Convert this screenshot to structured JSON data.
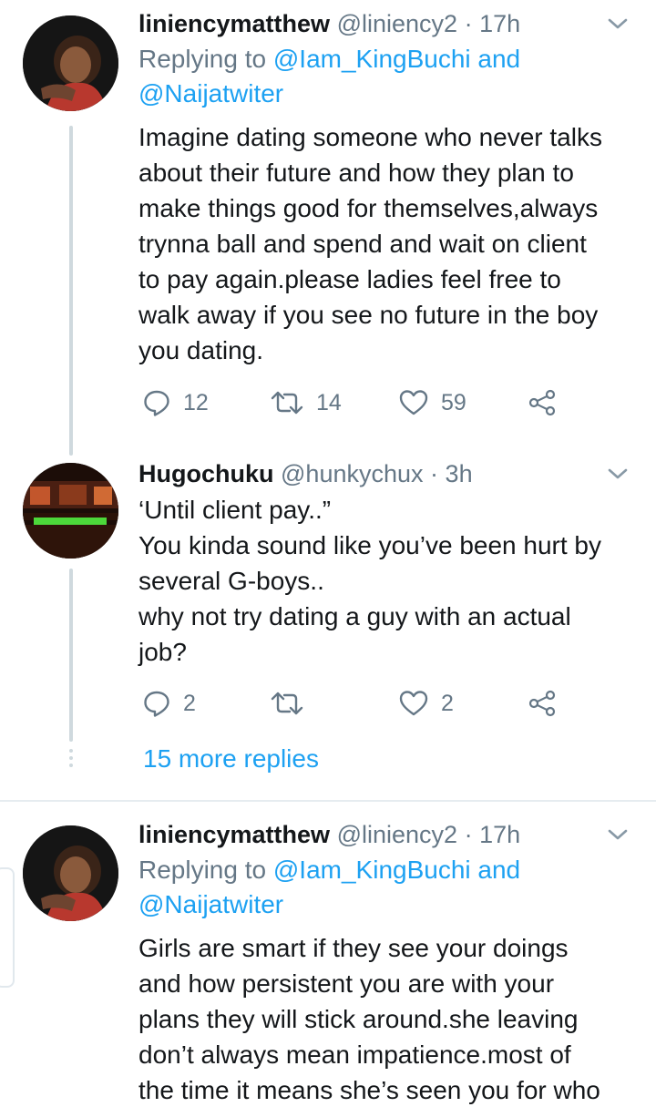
{
  "tweets": [
    {
      "name": "liniencymatthew",
      "handle": "@liniency2",
      "sep": "·",
      "time": "17h",
      "replying_prefix": "Replying to",
      "replying_mentions": "@Iam_KingBuchi and",
      "replying_mentions2": "@Naijatwiter",
      "body": "Imagine dating someone who never talks\nabout their future and how they plan to\nmake things good for themselves,always\ntrynna ball and spend and wait on client\nto pay again.please ladies feel free to\nwalk away if you see no future  in the boy\nyou dating.",
      "replies": "12",
      "retweets": "14",
      "likes": "59"
    },
    {
      "name": "Hugochuku",
      "handle": "@hunkychux",
      "sep": "·",
      "time": "3h",
      "body": "‘Until client pay..”\nYou  kinda sound like you’ve been hurt by\nseveral G-boys..\nwhy not try dating a guy with an actual\njob?",
      "replies": "2",
      "retweets": "",
      "likes": "2"
    },
    {
      "name": "liniencymatthew",
      "handle": "@liniency2",
      "sep": "·",
      "time": "17h",
      "replying_prefix": "Replying to",
      "replying_mentions": "@Iam_KingBuchi and",
      "replying_mentions2": "@Naijatwiter",
      "body": "Girls are smart if they see your doings\nand how persistent you are with your\nplans they will stick around.she leaving\ndon’t always mean impatience.most of\nthe time it means she’s seen you for who"
    }
  ],
  "more_replies": "15 more replies",
  "icons": {
    "reply": "reply-icon",
    "retweet": "retweet-icon",
    "like": "heart-icon",
    "share": "share-icon",
    "caret": "chevron-down-icon"
  },
  "colors": {
    "accent": "#1da1f2",
    "secondary": "#657786",
    "text": "#14171a",
    "thread": "#cfd9de"
  }
}
